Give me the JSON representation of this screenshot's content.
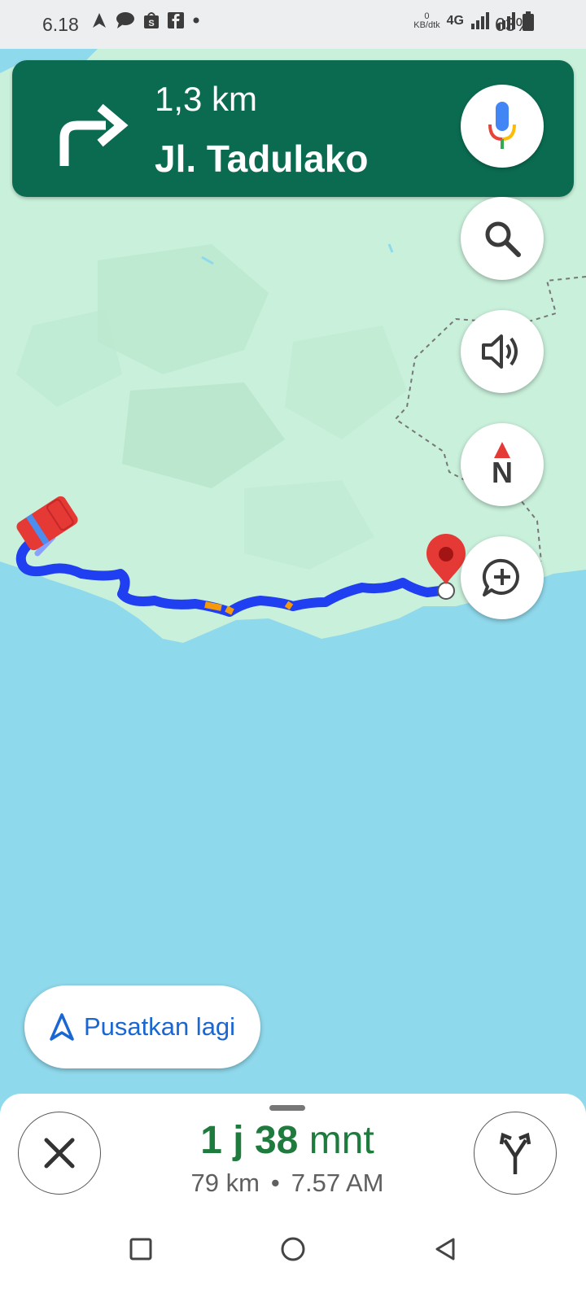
{
  "status_bar": {
    "time": "6.18",
    "net_speed_top": "0",
    "net_speed_unit": "KB/dtk",
    "network": "4G",
    "battery": "63%"
  },
  "banner": {
    "distance": "1,3 km",
    "street": "Jl. Tadulako",
    "turn_icon": "turn-right-icon",
    "color": "#0a6b50"
  },
  "recenter": {
    "label": "Pusatkan lagi"
  },
  "trip": {
    "duration_hours": "1 j",
    "duration_minutes": "38",
    "duration_unit": "mnt",
    "distance": "79 km",
    "separator": "•",
    "arrival": "7.57 AM",
    "color": "#1e7a3d"
  },
  "compass_label": "N",
  "colors": {
    "route": "#1f3ff0",
    "water": "#8fd9ec",
    "land": "#c9f0db",
    "pin": "#e53935"
  }
}
